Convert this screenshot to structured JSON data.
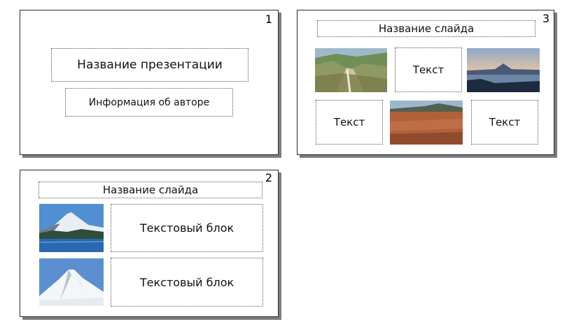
{
  "slides": [
    {
      "number": "1",
      "title": "Название презентации",
      "author": "Информация об авторе"
    },
    {
      "number": "2",
      "title": "Название слайда",
      "images": [
        "volcano-lake-photo",
        "snowy-volcano-photo"
      ],
      "blocks": [
        "Текстовый блок",
        "Текстовый блок"
      ]
    },
    {
      "number": "3",
      "title": "Название слайда",
      "images": [
        "valley-photo",
        "volcano-sunset-photo",
        "tundra-photo"
      ],
      "texts": [
        "Текст",
        "Текст",
        "Текст"
      ]
    }
  ]
}
